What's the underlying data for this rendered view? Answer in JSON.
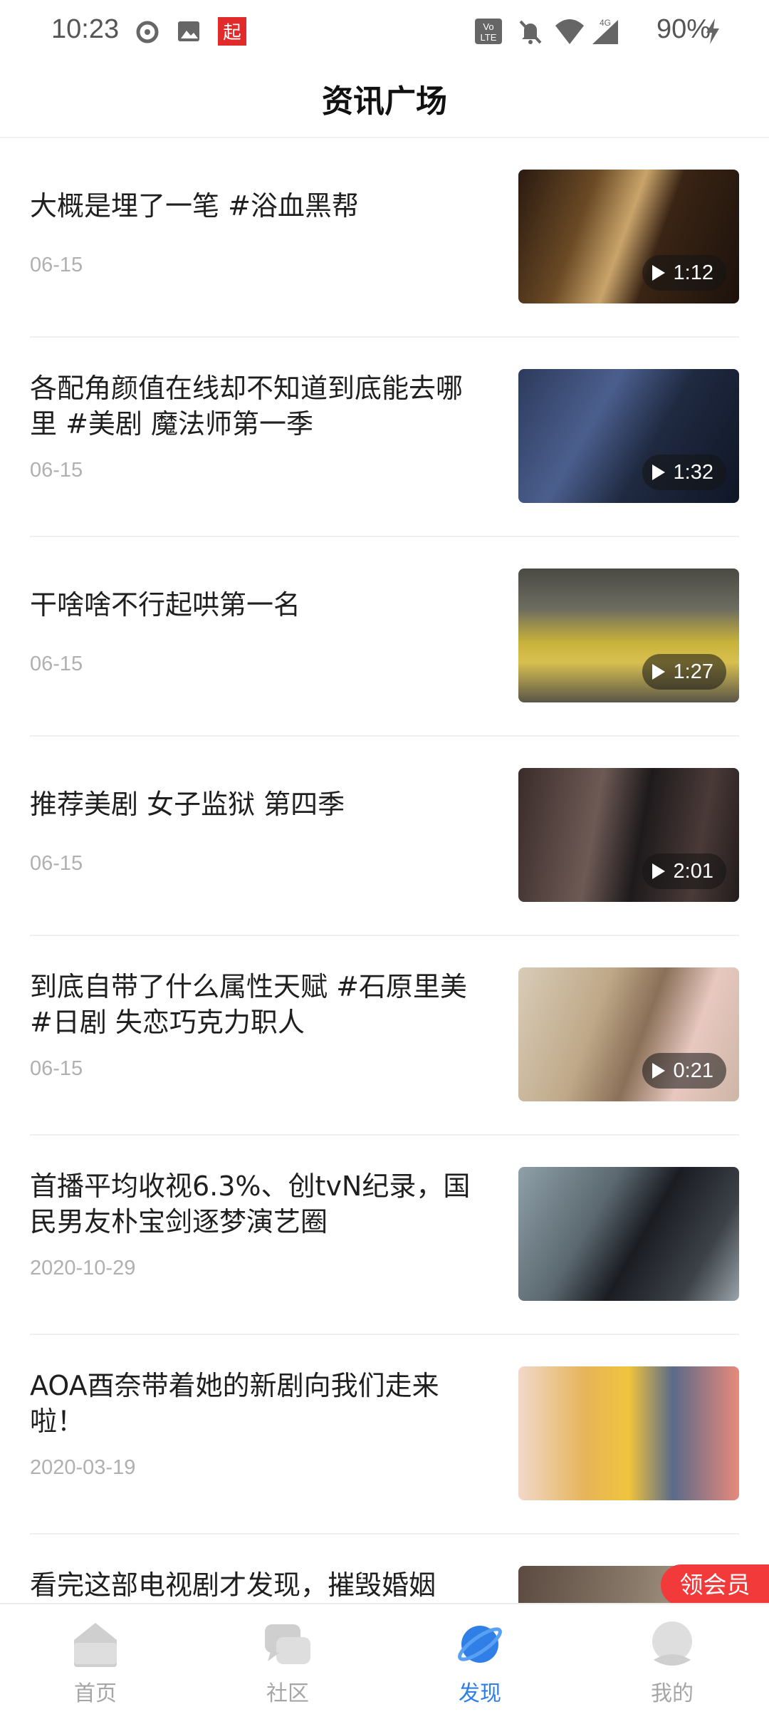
{
  "status_bar": {
    "time": "10:23",
    "battery": "90%",
    "notification_icons": [
      "netease-icon",
      "image-icon",
      "qidian-icon"
    ],
    "system_icons": [
      "volte-icon",
      "bell-off-icon",
      "wifi-icon",
      "signal-4g-icon",
      "charging-icon"
    ],
    "network_label": "4G"
  },
  "header": {
    "title": "资讯广场"
  },
  "feed": [
    {
      "title": "大概是埋了一笔 #浴血黑帮",
      "date": "06-15",
      "duration": "1:12"
    },
    {
      "title": "各配角颜值在线却不知道到底能去哪里 #美剧 魔法师第一季",
      "date": "06-15",
      "duration": "1:32"
    },
    {
      "title": "干啥啥不行起哄第一名",
      "date": "06-15",
      "duration": "1:27"
    },
    {
      "title": "推荐美剧 女子监狱 第四季",
      "date": "06-15",
      "duration": "2:01"
    },
    {
      "title": "到底自带了什么属性天赋 #石原里美 #日剧 失恋巧克力职人",
      "date": "06-15",
      "duration": "0:21"
    },
    {
      "title": "首播平均收视6.3%、创tvN纪录，国民男友朴宝剑逐梦演艺圈",
      "date": "2020-10-29",
      "duration": null
    },
    {
      "title": "AOA酉奈带着她的新剧向我们走来啦！",
      "date": "2020-03-19",
      "duration": null
    },
    {
      "title": "看完这部电视剧才发现，摧毁婚姻",
      "date": "",
      "duration": null
    }
  ],
  "vip_badge": "领会员",
  "tabs": [
    {
      "label": "首页",
      "icon": "home-icon",
      "active": false
    },
    {
      "label": "社区",
      "icon": "chat-icon",
      "active": false
    },
    {
      "label": "发现",
      "icon": "planet-icon",
      "active": true
    },
    {
      "label": "我的",
      "icon": "profile-icon",
      "active": false
    }
  ],
  "colors": {
    "accent": "#2f7fe6",
    "badge": "#f23a3a",
    "inactive_tab": "#a6a6a6",
    "date": "#b0b0b0"
  }
}
